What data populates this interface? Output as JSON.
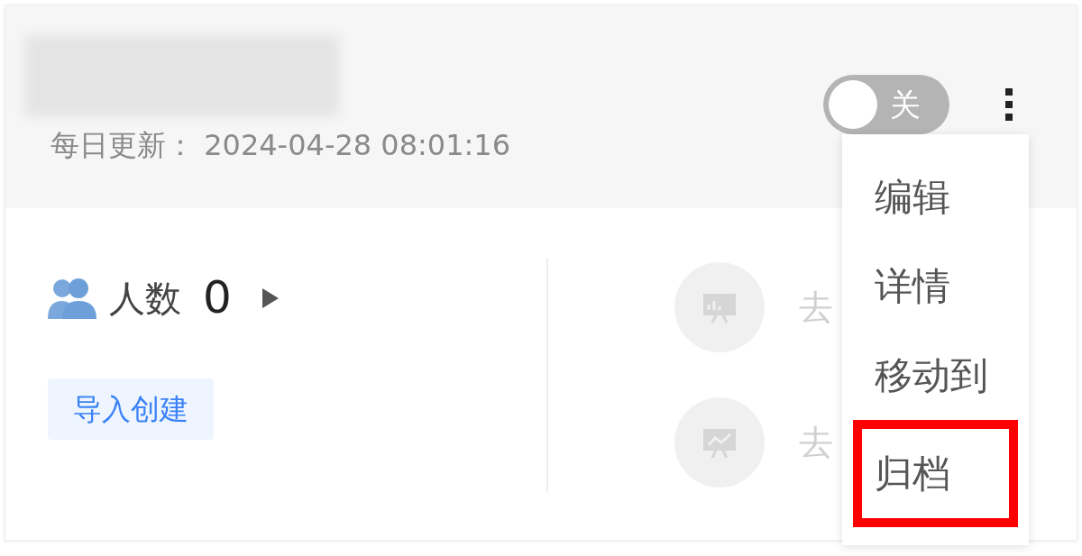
{
  "header": {
    "update_label": "每日更新：",
    "update_time": "2024-04-28 08:01:16",
    "toggle": {
      "label": "关",
      "on": false
    }
  },
  "stats": {
    "label": "人数",
    "count": "0"
  },
  "import_button": "导入创建",
  "actions": [
    {
      "kind": "board",
      "label": "去"
    },
    {
      "kind": "trend",
      "label": "去"
    }
  ],
  "menu": {
    "items": [
      {
        "label": "编辑",
        "highlighted": false
      },
      {
        "label": "详情",
        "highlighted": false
      },
      {
        "label": "移动到",
        "highlighted": false
      },
      {
        "label": "归档",
        "highlighted": true
      }
    ]
  }
}
